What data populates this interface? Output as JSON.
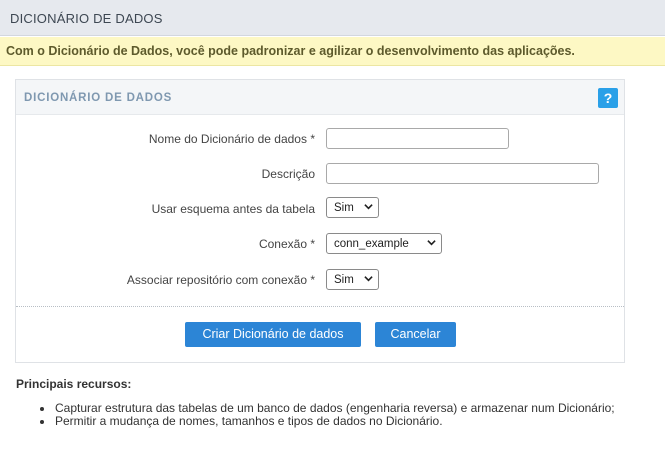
{
  "header": {
    "title": "DICIONÁRIO DE DADOS"
  },
  "banner": {
    "text": "Com o Dicionário de Dados, você pode padronizar e agilizar o desenvolvimento das aplicações."
  },
  "panel": {
    "title": "DICIONÁRIO DE DADOS",
    "help_label": "?",
    "fields": {
      "name": {
        "label": "Nome do Dicionário de dados *",
        "value": ""
      },
      "description": {
        "label": "Descrição",
        "value": ""
      },
      "schema": {
        "label": "Usar esquema antes da tabela",
        "value": "Sim"
      },
      "connection": {
        "label": "Conexão *",
        "value": "conn_example"
      },
      "repository": {
        "label": "Associar repositório com conexão *",
        "value": "Sim"
      }
    },
    "buttons": {
      "create": "Criar Dicionário de dados",
      "cancel": "Cancelar"
    }
  },
  "features": {
    "title": "Principais recursos:",
    "items": [
      "Capturar estrutura das tabelas de um banco de dados (engenharia reversa) e armazenar num Dicionário;",
      "Permitir a mudança de nomes, tamanhos e tipos de dados no Dicionário."
    ]
  },
  "colors": {
    "primary_button": "#2c85d6",
    "help_icon": "#2aa0e8",
    "banner_bg": "#fdf8c4"
  }
}
